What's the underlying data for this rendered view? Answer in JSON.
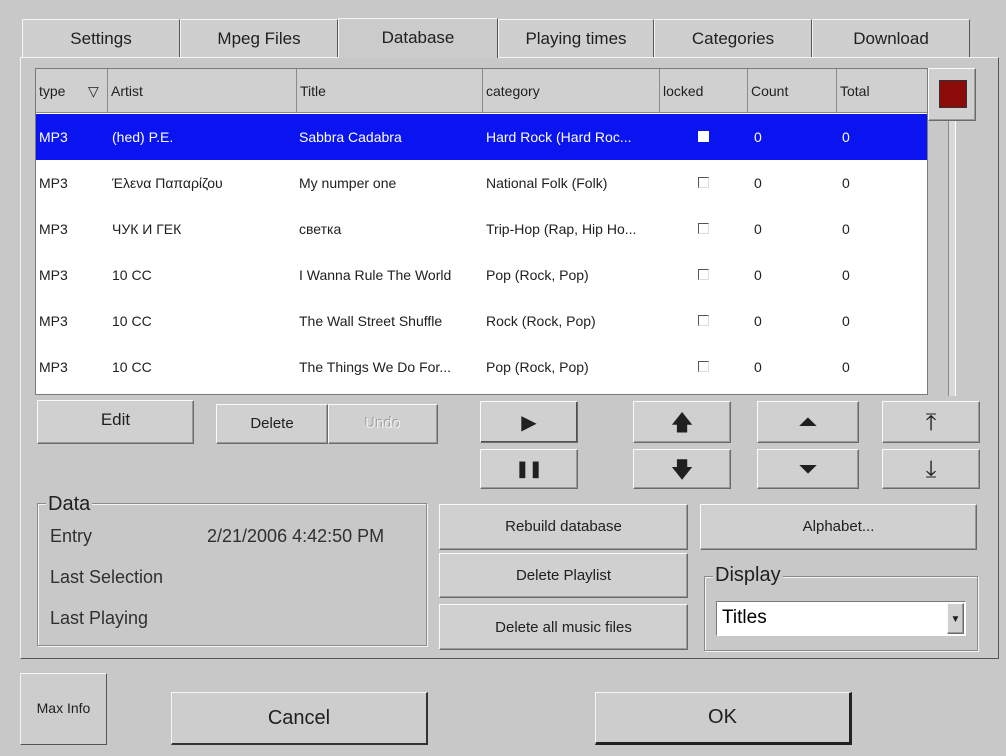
{
  "tabs": [
    {
      "label": "Settings"
    },
    {
      "label": "Mpeg Files"
    },
    {
      "label": "Database"
    },
    {
      "label": "Playing times"
    },
    {
      "label": "Categories"
    },
    {
      "label": "Download"
    }
  ],
  "active_tab": "Database",
  "table": {
    "sort_indicator": "▽",
    "headers": [
      "type",
      "Artist",
      "Title",
      "category",
      "locked",
      "Count",
      "Total"
    ],
    "rows": [
      {
        "type": "MP3",
        "artist": "(hed) P.E.",
        "title": "Sabbra Cadabra",
        "category": "Hard Rock (Hard Roc...",
        "locked": false,
        "count": "0",
        "total": "0",
        "selected": true
      },
      {
        "type": "MP3",
        "artist": "Έλενα Παπαρίζου",
        "title": "My numper one",
        "category": "National Folk (Folk)",
        "locked": false,
        "count": "0",
        "total": "0",
        "selected": false
      },
      {
        "type": "MP3",
        "artist": "ЧУК И ГЕК",
        "title": "светка",
        "category": "Trip-Hop (Rap, Hip Ho...",
        "locked": false,
        "count": "0",
        "total": "0",
        "selected": false
      },
      {
        "type": "MP3",
        "artist": "10 CC",
        "title": "I Wanna Rule The World",
        "category": "Pop (Rock, Pop)",
        "locked": false,
        "count": "0",
        "total": "0",
        "selected": false
      },
      {
        "type": "MP3",
        "artist": "10 CC",
        "title": "The Wall Street Shuffle",
        "category": "Rock (Rock, Pop)",
        "locked": false,
        "count": "0",
        "total": "0",
        "selected": false
      },
      {
        "type": "MP3",
        "artist": "10 CC",
        "title": "The Things We Do For...",
        "category": "Pop (Rock, Pop)",
        "locked": false,
        "count": "0",
        "total": "0",
        "selected": false
      }
    ],
    "selection_color": "#0a14f0"
  },
  "buttons": {
    "edit": "Edit",
    "delete": "Delete",
    "undo": "Undo",
    "play": "▶",
    "pause": "❚❚",
    "up": "🡅",
    "down": "🡇",
    "page_up": "⏶",
    "page_down": "⏷",
    "top": "⤒",
    "bottom": "⤓",
    "rebuild_database": "Rebuild database",
    "alphabet": "Alphabet...",
    "delete_playlist": "Delete Playlist",
    "delete_all_music_files": "Delete all music files",
    "max_info": "Max Info",
    "cancel": "Cancel",
    "ok": "OK"
  },
  "data_group": {
    "title": "Data",
    "entry_label": "Entry",
    "entry_value": "2/21/2006 4:42:50 PM",
    "last_selection_label": "Last Selection",
    "last_playing_label": "Last Playing"
  },
  "display_group": {
    "title": "Display",
    "selected": "Titles"
  },
  "colors": {
    "stop_square": "#8b0a0a"
  }
}
